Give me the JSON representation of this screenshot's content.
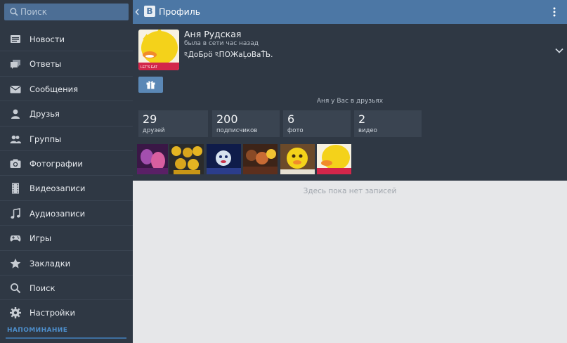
{
  "search": {
    "placeholder": "Поиск"
  },
  "menu": {
    "items": [
      {
        "icon": "news-icon",
        "label": "Новости"
      },
      {
        "icon": "replies-icon",
        "label": "Ответы"
      },
      {
        "icon": "messages-icon",
        "label": "Сообщения"
      },
      {
        "icon": "friends-icon",
        "label": "Друзья"
      },
      {
        "icon": "groups-icon",
        "label": "Группы"
      },
      {
        "icon": "photos-icon",
        "label": "Фотографии"
      },
      {
        "icon": "videos-icon",
        "label": "Видеозаписи"
      },
      {
        "icon": "audio-icon",
        "label": "Аудиозаписи"
      },
      {
        "icon": "games-icon",
        "label": "Игры"
      },
      {
        "icon": "bookmarks-icon",
        "label": "Закладки"
      },
      {
        "icon": "search-icon",
        "label": "Поиск"
      },
      {
        "icon": "settings-icon",
        "label": "Настройки"
      }
    ],
    "reminder_label": "НАПОМИНАНИЕ"
  },
  "header": {
    "title": "Профиль"
  },
  "profile": {
    "name": "Аня Рудская",
    "online": "была в сети час назад",
    "status": "ঽДоБрö ঽПОЖаĻоВаŤЬ.",
    "friend_note": "Аня у Вас в друзьях",
    "counters": [
      {
        "value": "29",
        "label": "друзей"
      },
      {
        "value": "200",
        "label": "подписчиков"
      },
      {
        "value": "6",
        "label": "фото"
      },
      {
        "value": "2",
        "label": "видео"
      }
    ]
  },
  "wall": {
    "empty_text": "Здесь пока нет записей"
  },
  "colors": {
    "sidebar_bg": "#2f3844",
    "topbar_bg": "#4c77a5",
    "accent": "#4d8ecb",
    "wall_bg": "#e6e7e9"
  }
}
